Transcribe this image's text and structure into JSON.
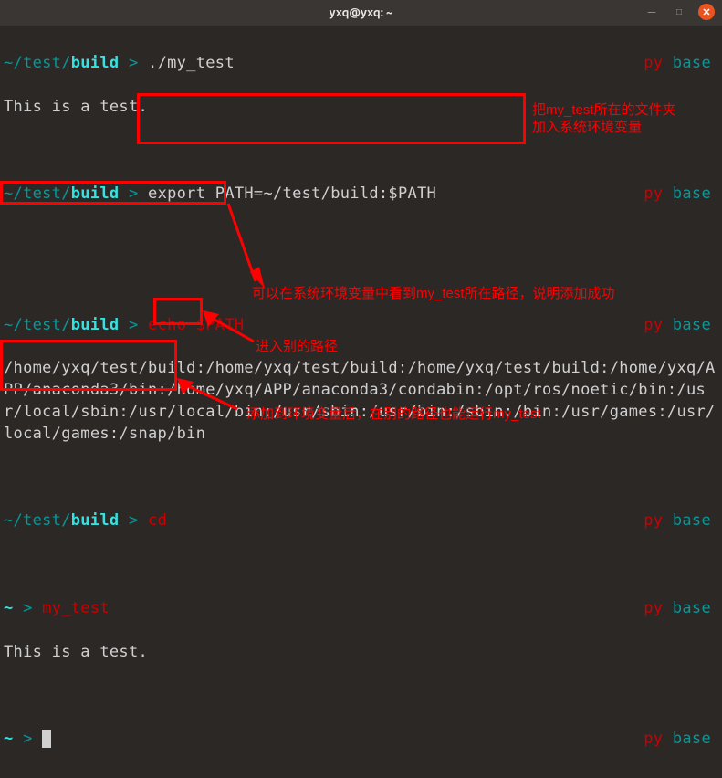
{
  "window": {
    "title": "yxq@yxq: ~"
  },
  "lines": [
    {
      "prompt_path": "~/test/",
      "prompt_dir": "build",
      "cmd": "./my_test",
      "badge": "py base"
    },
    {
      "output": "This is a test."
    },
    {
      "blank": true
    },
    {
      "prompt_path": "~/test/",
      "prompt_dir": "build",
      "cmd": "export PATH=~/test/build:$PATH",
      "badge": "py base"
    },
    {
      "blank": true
    },
    {
      "blank": true
    },
    {
      "prompt_path": "~/test/",
      "prompt_dir": "build",
      "cmd": "echo $PATH",
      "badge": "py base"
    },
    {
      "output": "/home/yxq/test/build:/home/yxq/test/build:/home/yxq/test/build:/home/yxq/APP/anaconda3/bin:/home/yxq/APP/anaconda3/condabin:/opt/ros/noetic/bin:/usr/local/sbin:/usr/local/bin:/usr/sbin:/usr/bin:/sbin:/bin:/usr/games:/usr/local/games:/snap/bin"
    },
    {
      "blank": true
    },
    {
      "prompt_path": "~/test/",
      "prompt_dir": "build",
      "cmd": "cd",
      "badge": "py base"
    },
    {
      "blank": true
    },
    {
      "prompt_home": "~",
      "cmd": "my_test",
      "badge": "py base"
    },
    {
      "output": "This is a test."
    },
    {
      "blank": true
    },
    {
      "prompt_home": "~",
      "cursor": true,
      "badge": "py base"
    }
  ],
  "annotations": {
    "box1_desc": "export command highlight",
    "text1": "把my_test所在的文件夹",
    "text1b": "加入系统环境变量",
    "box2_desc": "path output highlight",
    "text2": "可以在系统环境变量中看到my_test所在路径，说明添加成功",
    "box3_desc": "cd command highlight",
    "text3": "进入别的路径",
    "box4_desc": "my_test run highlight",
    "text4": "添加到环境变量后，在别的路径也能运行my_test"
  }
}
